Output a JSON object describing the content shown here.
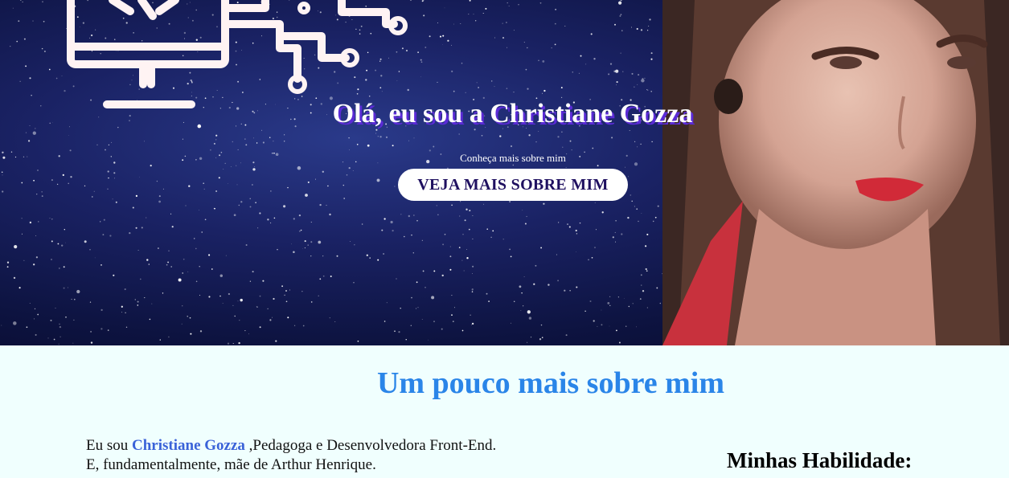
{
  "hero": {
    "title": "Olá, eu sou a Christiane Gozza",
    "subtitle": "Conheça mais sobre mim",
    "button_label": "VEJA MAIS SOBRE MIM"
  },
  "about": {
    "title": "Um pouco mais sobre mim",
    "text_before": "Eu sou ",
    "name": "Christiane Gozza",
    "text_after": " ,Pedagoga e Desenvolvedora Front-End. E, fundamentalmente, mãe de Arthur Henrique."
  },
  "skills": {
    "title": "Minhas Habilidade:"
  },
  "colors": {
    "title_shadow": "#5b2bd6",
    "about_title": "#2a85e8",
    "name_highlight": "#3a62d8",
    "page_background": "#f0fffe"
  },
  "icons": {
    "hero_graphic": "computer-circuit-icon"
  }
}
